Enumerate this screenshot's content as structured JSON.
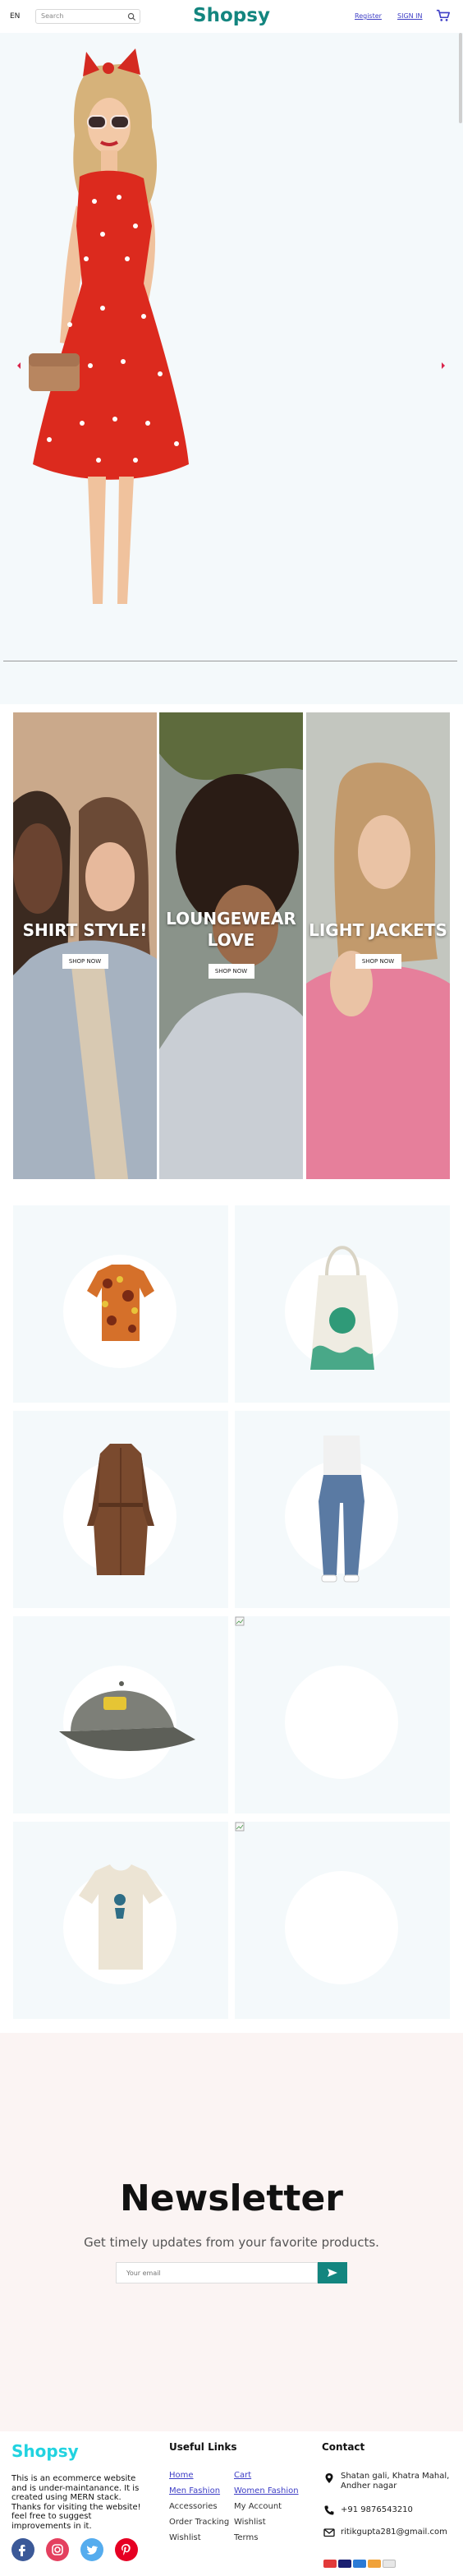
{
  "header": {
    "lang": "EN",
    "search_placeholder": "Search",
    "logo": "Shopsy",
    "register": "Register",
    "signin": "SIGN IN"
  },
  "categories": [
    {
      "title": "SHIRT STYLE!",
      "button": "SHOP NOW"
    },
    {
      "title": "LOUNGEWEAR LOVE",
      "button": "SHOP NOW"
    },
    {
      "title": "LIGHT JACKETS",
      "button": "SHOP NOW"
    }
  ],
  "products": [
    {
      "icon": "printed-shirt-icon"
    },
    {
      "icon": "tote-bag-icon"
    },
    {
      "icon": "trench-coat-icon"
    },
    {
      "icon": "jeans-model-icon"
    },
    {
      "icon": "baseball-cap-icon"
    },
    {
      "icon": "broken-image-icon"
    },
    {
      "icon": "tshirt-icon"
    },
    {
      "icon": "broken-image-icon"
    }
  ],
  "newsletter": {
    "title": "Newsletter",
    "subtitle": "Get timely updates from your favorite products.",
    "placeholder": "Your email"
  },
  "footer": {
    "logo": "Shopsy",
    "description": "This is an ecommerce website and is under-maintanance. It is created using MERN stack. Thanks for visiting the website! feel free to suggest improvements in it.",
    "useful_links_title": "Useful Links",
    "links_left": [
      "Home",
      "Men Fashion",
      "Accessories",
      "Order Tracking",
      "Wishlist"
    ],
    "links_right": [
      "Cart",
      "Women Fashion",
      "My Account",
      "Wishlist",
      "Terms"
    ],
    "contact_title": "Contact",
    "address": "Shatan gali, Khatra Mahal, Andher nagar",
    "phone": "+91 9876543210",
    "email": "ritikgupta281@gmail.com"
  },
  "colors": {
    "brand": "#13857f",
    "footer_logo": "#21d3e0",
    "link": "#3f3fc6",
    "hero_bg": "#f4f9fb",
    "newsletter_bg": "#fbf4f3"
  }
}
